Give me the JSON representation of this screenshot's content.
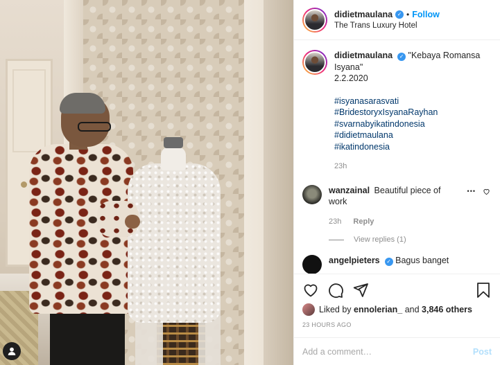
{
  "header": {
    "username": "didietmaulana",
    "separator": "•",
    "follow_label": "Follow",
    "location": "The Trans Luxury Hotel"
  },
  "caption": {
    "username": "didietmaulana",
    "lines": [
      "\"Kebaya Romansa",
      "Isyana\"",
      "2.2.2020"
    ],
    "hashtags": [
      "#isyanasarasvati",
      "#BridestoryxIsyanaRayhan",
      "#svarnabyikatindonesia",
      "#didietmaulana",
      "#ikatindonesia"
    ],
    "time": "23h"
  },
  "comments": [
    {
      "username": "wanzainal",
      "text_line1": "Beautiful piece of",
      "text_line2": "work",
      "time": "23h",
      "reply_label": "Reply",
      "more_label": "•••",
      "view_replies": "View replies (1)"
    },
    {
      "username": "angelpieters",
      "text": "Bagus banget"
    }
  ],
  "likes": {
    "prefix": "Liked by",
    "user": "ennolerian_",
    "middle": "and",
    "count": "3,846 others"
  },
  "timestamp": "23 HOURS AGO",
  "add_comment": {
    "placeholder": "Add a comment…",
    "post_label": "Post"
  },
  "colors": {
    "accent": "#0095f6",
    "verified": "#3897f0",
    "muted": "#8e8e8e",
    "hashtag": "#00376b",
    "post_disabled": "#b2dffc"
  }
}
